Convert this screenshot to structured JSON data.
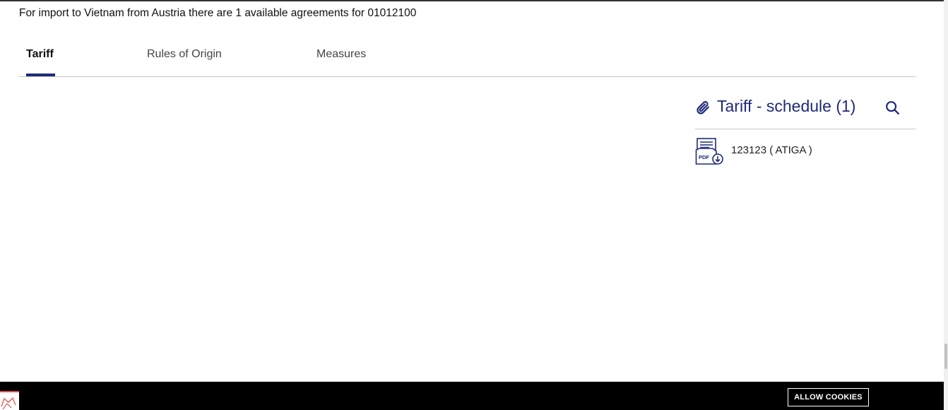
{
  "headline": "For import to Vietnam from Austria there are 1 available agreements for 01012100",
  "tabs": [
    {
      "label": "Tariff",
      "active": true
    },
    {
      "label": "Rules of Origin",
      "active": false
    },
    {
      "label": "Measures",
      "active": false
    }
  ],
  "panel": {
    "title": "Tariff - schedule (1)",
    "icon": "paperclip-icon",
    "search_icon": "search-icon",
    "files": [
      {
        "label": "123123 ( ATIGA )",
        "icon": "pdf-download-icon"
      }
    ]
  },
  "cookie_bar": {
    "button_label": "ALLOW COOKIES"
  },
  "colors": {
    "accent": "#1f2a77",
    "cookie_bg": "#000000"
  }
}
